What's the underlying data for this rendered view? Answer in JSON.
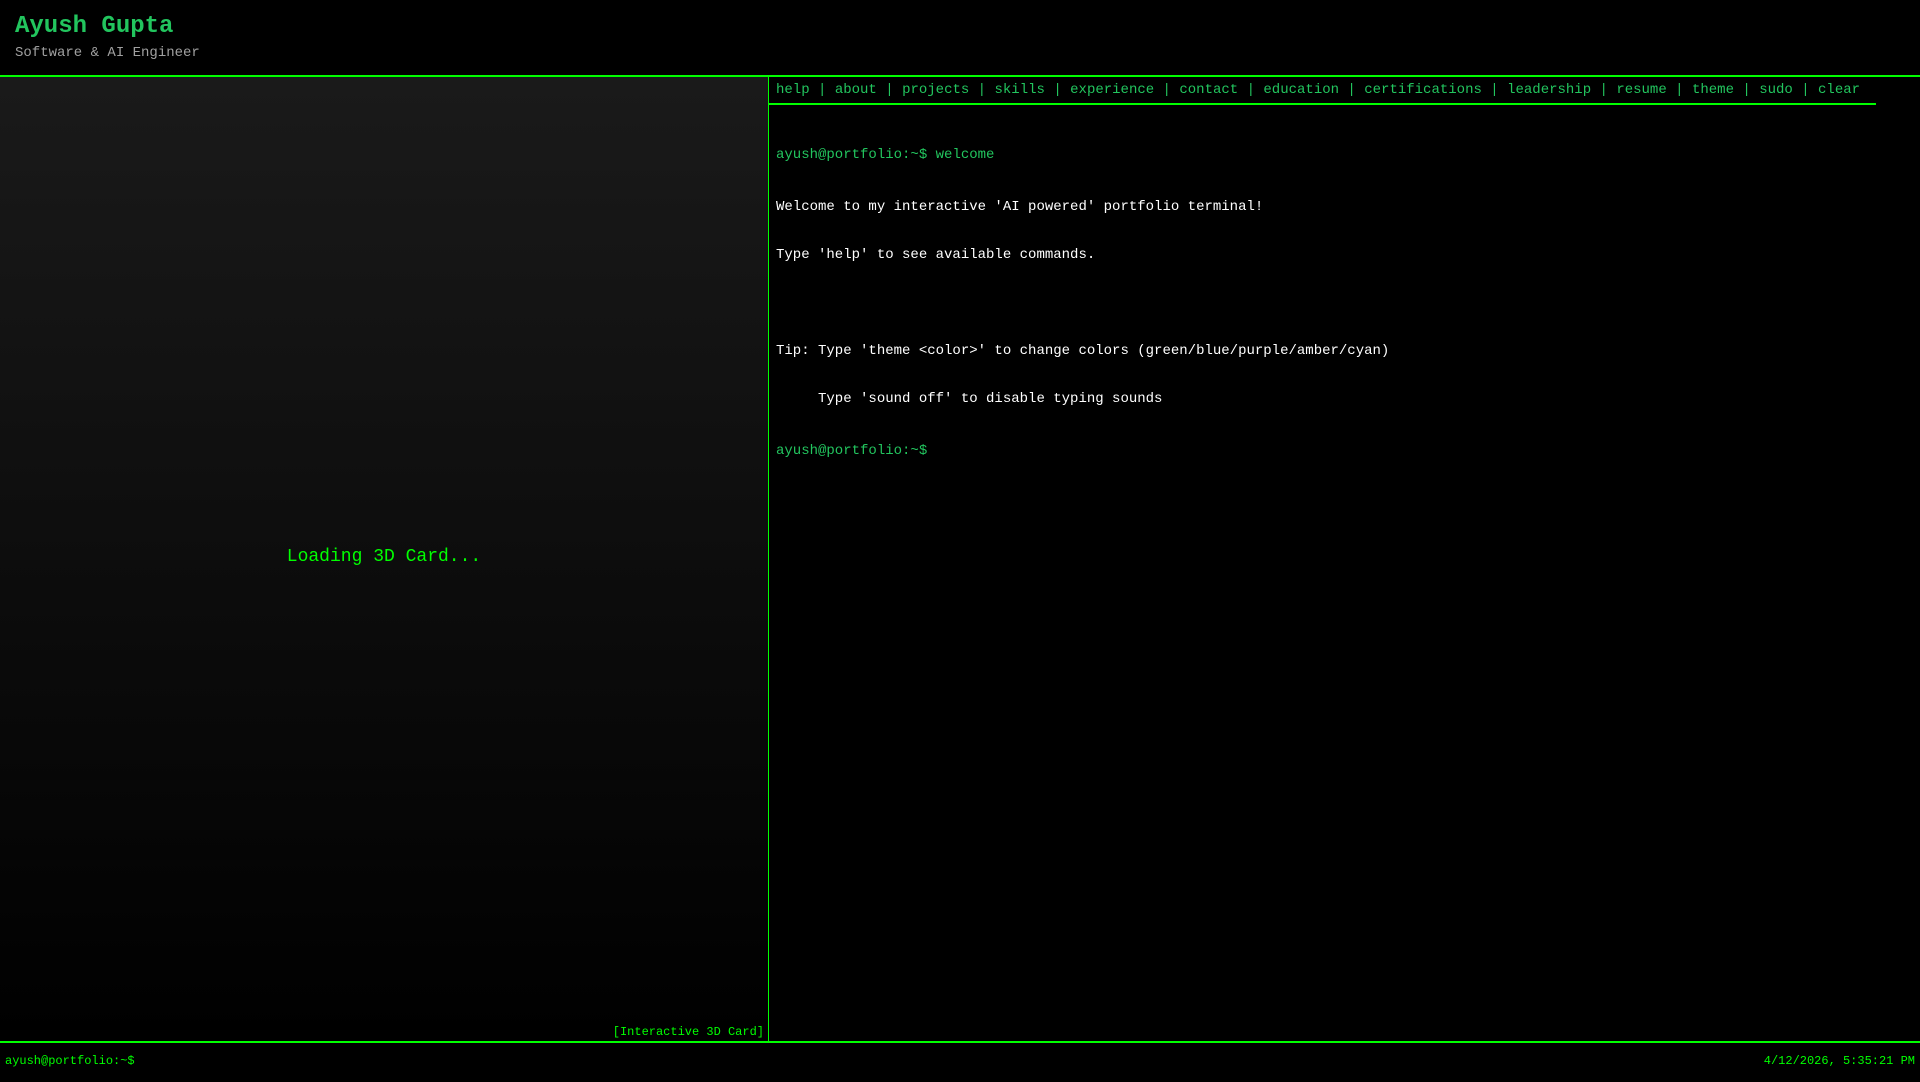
{
  "header": {
    "title": "Ayush Gupta",
    "subtitle": "Software & AI Engineer"
  },
  "card": {
    "loading": "Loading 3D Card...",
    "label": "[Interactive 3D Card]"
  },
  "nav": {
    "items": [
      "help",
      "about",
      "projects",
      "skills",
      "experience",
      "contact",
      "education",
      "certifications",
      "leadership",
      "resume",
      "theme",
      "sudo",
      "clear"
    ],
    "separator": " | "
  },
  "terminal": {
    "prompt": "ayush@portfolio:~$",
    "command": "welcome",
    "output": [
      "Welcome to my interactive 'AI powered' portfolio terminal!",
      "Type 'help' to see available commands.",
      "",
      "Tip: Type 'theme <color>' to change colors (green/blue/purple/amber/cyan)",
      "     Type 'sound off' to disable typing sounds"
    ]
  },
  "footer": {
    "prompt": "ayush@portfolio:~$",
    "datetime": "4/12/2026, 5:35:21 PM"
  },
  "colors": {
    "accent": "#22c55e",
    "border": "#00ff00"
  }
}
